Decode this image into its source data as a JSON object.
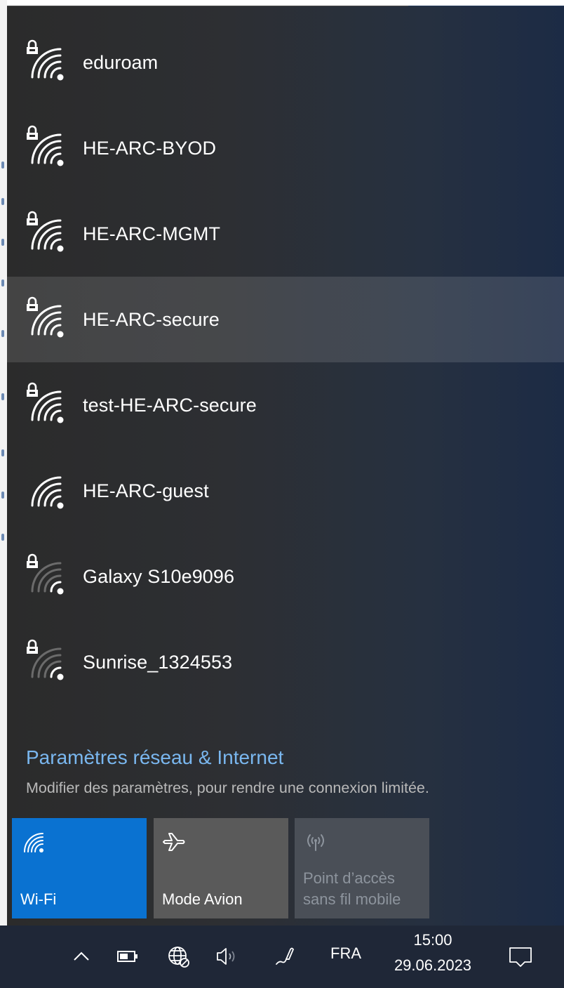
{
  "networks": [
    {
      "name": "eduroam",
      "secured": true,
      "signal": "strong",
      "selected": false
    },
    {
      "name": "HE-ARC-BYOD",
      "secured": true,
      "signal": "strong",
      "selected": false
    },
    {
      "name": "HE-ARC-MGMT",
      "secured": true,
      "signal": "strong",
      "selected": false
    },
    {
      "name": "HE-ARC-secure",
      "secured": true,
      "signal": "strong",
      "selected": true
    },
    {
      "name": "test-HE-ARC-secure",
      "secured": true,
      "signal": "strong",
      "selected": false
    },
    {
      "name": "HE-ARC-guest",
      "secured": false,
      "signal": "strong",
      "selected": false
    },
    {
      "name": "Galaxy S10e9096",
      "secured": true,
      "signal": "weak",
      "selected": false
    },
    {
      "name": "Sunrise_1324553",
      "secured": true,
      "signal": "weak",
      "selected": false
    }
  ],
  "settings": {
    "link_label": "Paramètres réseau & Internet",
    "description": "Modifier des paramètres, pour rendre une connexion limitée."
  },
  "quick_actions": {
    "wifi": {
      "label": "Wi-Fi",
      "icon": "wifi-icon",
      "active": true
    },
    "airplane": {
      "label": "Mode Avion",
      "icon": "airplane-icon",
      "active": false
    },
    "hotspot": {
      "line1": "Point d’accès",
      "line2": "sans fil mobile",
      "icon": "hotspot-icon",
      "disabled": true
    }
  },
  "taskbar": {
    "language": "FRA",
    "time": "15:00",
    "date": "29.06.2023",
    "icons": [
      "chevron-up-icon",
      "battery-icon",
      "globe-network-icon",
      "speaker-icon",
      "pen-icon",
      "notification-icon"
    ]
  },
  "colors": {
    "accent": "#0a72d1",
    "link": "#7ab7ef",
    "panel": "#2b2b2b",
    "taskbar": "#1f2737"
  }
}
